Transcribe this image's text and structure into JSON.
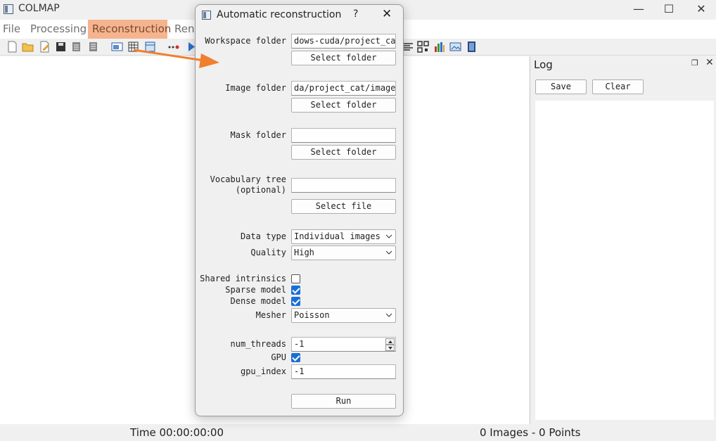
{
  "app": {
    "title": "COLMAP",
    "controls": {
      "minimize": "—",
      "maximize": "☐",
      "close": "✕"
    }
  },
  "menubar": {
    "items": [
      {
        "label": "File"
      },
      {
        "label": "Processing"
      },
      {
        "label": "Reconstruction",
        "highlighted": true
      },
      {
        "label": "Rend"
      }
    ],
    "highlight_color": "#f5b48d"
  },
  "toolbar": {
    "icons": [
      "new-project-icon",
      "open-project-icon",
      "edit-project-icon",
      "save-project-icon",
      "import-icon",
      "export-icon",
      "image-view-icon",
      "grid-view-icon",
      "table-view-icon",
      "match-icon",
      "play-icon",
      "text-align-icon",
      "qr-icon",
      "bar-chart-icon",
      "image-icon",
      "film-icon"
    ]
  },
  "dialog": {
    "title": "Automatic reconstruction",
    "help": "?",
    "close": "✕",
    "workspace": {
      "label": "Workspace folder",
      "value": "dows-cuda/project_cat",
      "button": "Select folder"
    },
    "image": {
      "label": "Image folder",
      "value": "da/project_cat/images",
      "button": "Select folder"
    },
    "mask": {
      "label": "Mask folder",
      "value": "",
      "button": "Select folder"
    },
    "vocab": {
      "label_line1": "Vocabulary tree",
      "label_line2": "(optional)",
      "value": "",
      "button": "Select file"
    },
    "data_type": {
      "label": "Data type",
      "value": "Individual images"
    },
    "quality": {
      "label": "Quality",
      "value": "High"
    },
    "shared_intrinsics": {
      "label": "Shared intrinsics",
      "checked": false
    },
    "sparse_model": {
      "label": "Sparse model",
      "checked": true
    },
    "dense_model": {
      "label": "Dense model",
      "checked": true
    },
    "mesher": {
      "label": "Mesher",
      "value": "Poisson"
    },
    "num_threads": {
      "label": "num_threads",
      "value": "-1"
    },
    "gpu": {
      "label": "GPU",
      "checked": true
    },
    "gpu_index": {
      "label": "gpu_index",
      "value": "-1"
    },
    "run": "Run",
    "check_color": "#1a6fd6"
  },
  "log": {
    "title": "Log",
    "save": "Save",
    "clear": "Clear"
  },
  "status": {
    "time": "Time 00:00:00:00",
    "counts": "0 Images - 0 Points"
  },
  "annotation": {
    "arrow_color": "#f07f2f"
  }
}
